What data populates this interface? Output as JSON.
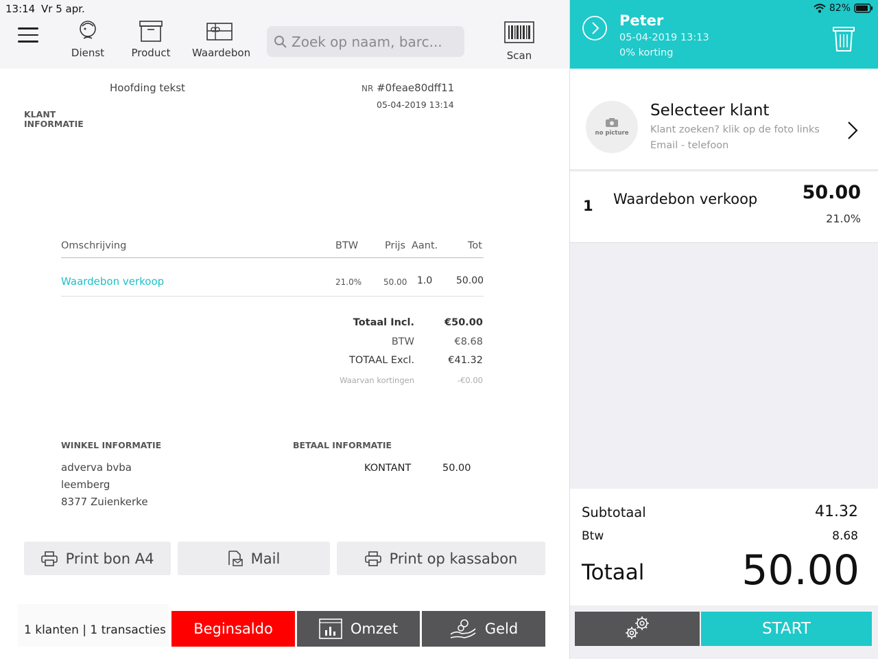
{
  "status": {
    "time": "13:14",
    "date": "Vr 5 apr.",
    "battery": "82%"
  },
  "toolbar": {
    "dienst": "Dienst",
    "product": "Product",
    "waardebon": "Waardebon",
    "scan": "Scan",
    "search_placeholder": "Zoek op naam, barc..."
  },
  "receipt": {
    "heading": "Hoofding tekst",
    "nr_prefix": "NR",
    "nr": "#0feae80dff11",
    "datetime": "05-04-2019 13:14",
    "klant_label": "KLANT INFORMATIE",
    "columns": {
      "desc": "Omschrijving",
      "btw": "BTW",
      "prijs": "Prijs",
      "aant": "Aant.",
      "tot": "Tot"
    },
    "row": {
      "desc": "Waardebon verkoop",
      "btw": "21.0%",
      "prijs": "50.00",
      "aant": "1.0",
      "tot": "50.00"
    },
    "totals": {
      "incl_label": "Totaal Incl.",
      "incl": "€50.00",
      "btw_label": "BTW",
      "btw": "€8.68",
      "excl_label": "TOTAAL Excl.",
      "excl": "€41.32",
      "disc_label": "Waarvan kortingen",
      "disc": "-€0.00"
    },
    "store_title": "WINKEL INFORMATIE",
    "store_lines": [
      "adverva bvba",
      "leemberg",
      "8377 Zuienkerke"
    ],
    "pay_title": "BETAAL INFORMATIE",
    "pay_method": "KONTANT",
    "pay_amount": "50.00"
  },
  "actions": {
    "print_a4": "Print bon A4",
    "mail": "Mail",
    "print_kassabon": "Print op kassabon"
  },
  "footer": {
    "info": "1 klanten | 1 transacties",
    "beginsaldo": "Beginsaldo",
    "omzet": "Omzet",
    "geld": "Geld"
  },
  "colors": {
    "accent": "#1fc8c9",
    "red": "#ff0000",
    "dark": "#555557"
  },
  "order": {
    "customer": "Peter",
    "datetime": "05-04-2019 13:13",
    "discount": "0% korting",
    "client_title": "Selecteer klant",
    "client_sub1": "Klant zoeken? klik op de foto links",
    "client_sub2": "Email - telefoon",
    "no_picture": "no picture",
    "item": {
      "qty": "1",
      "name": "Waardebon verkoop",
      "price": "50.00",
      "vat": "21.0%"
    },
    "subtotal_label": "Subtotaal",
    "subtotal": "41.32",
    "btw_label": "Btw",
    "btw": "8.68",
    "total_label": "Totaal",
    "total": "50.00",
    "start": "START"
  }
}
